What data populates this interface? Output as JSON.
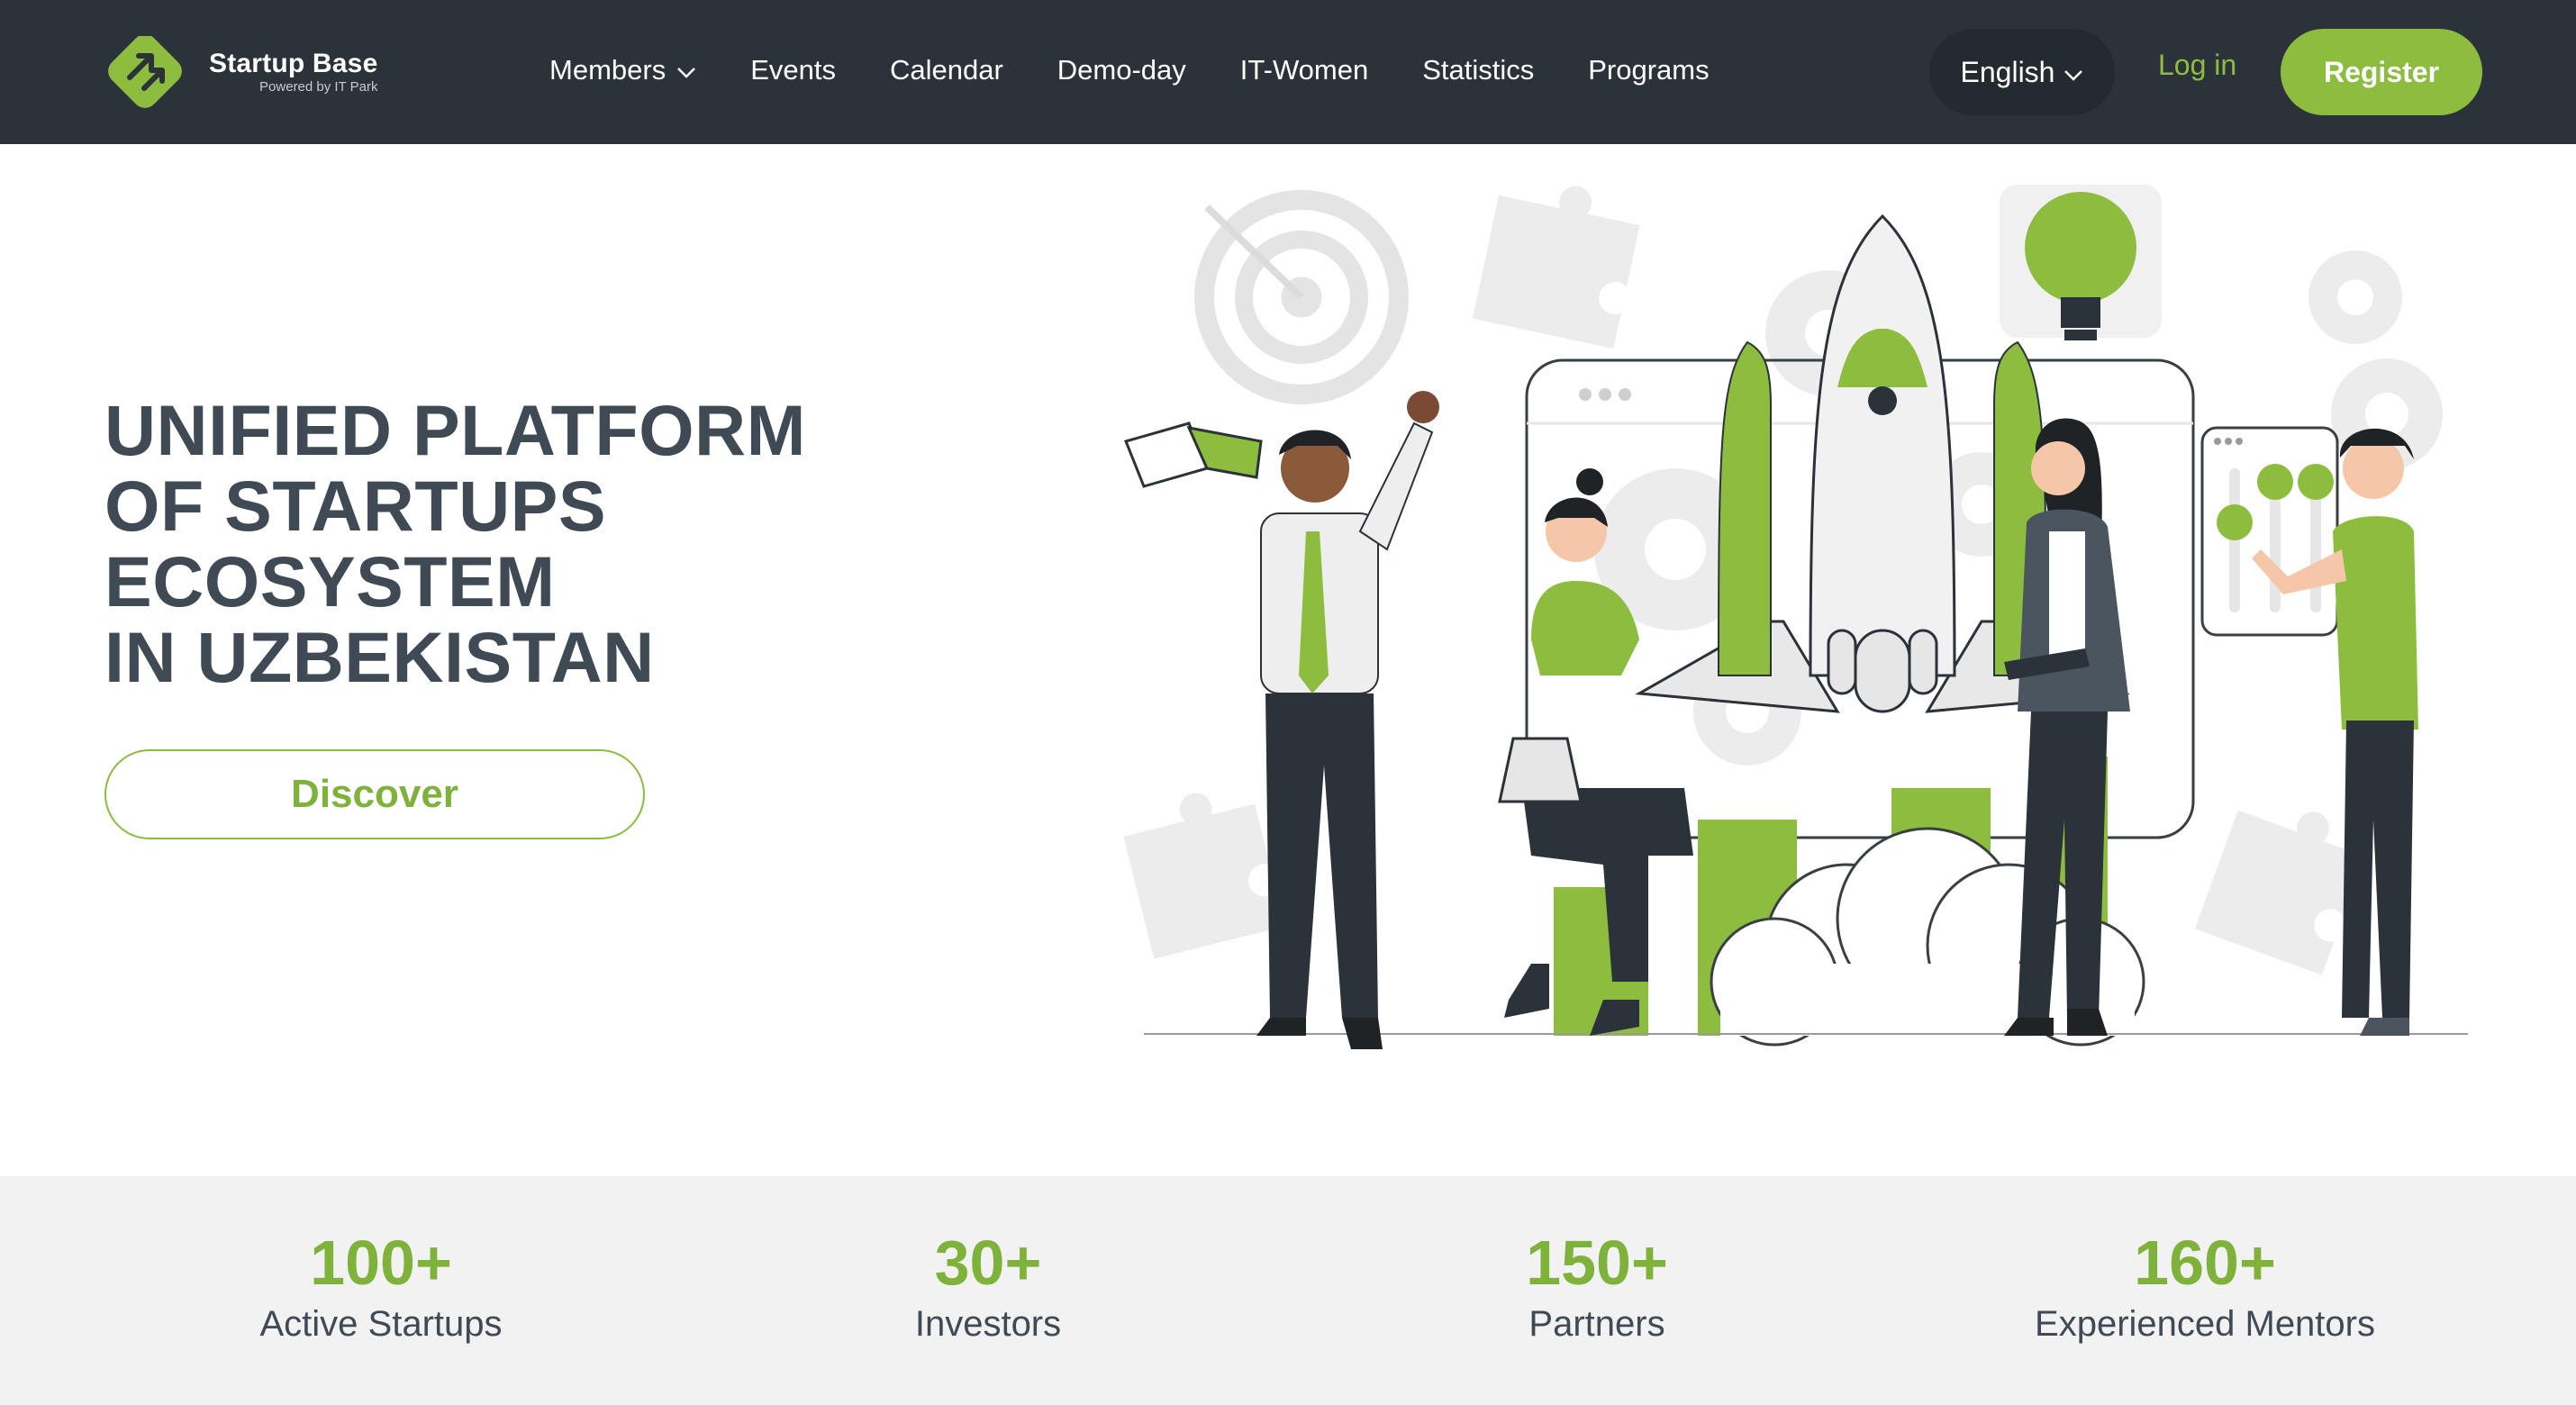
{
  "header": {
    "logo_name": "Startup Base",
    "logo_sub": "Powered by IT Park",
    "nav": [
      {
        "label": "Members",
        "has_dropdown": true
      },
      {
        "label": "Events"
      },
      {
        "label": "Calendar"
      },
      {
        "label": "Demo-day"
      },
      {
        "label": "IT-Women"
      },
      {
        "label": "Statistics"
      },
      {
        "label": "Programs"
      }
    ],
    "language": "English",
    "login_label": "Log in",
    "register_label": "Register"
  },
  "hero": {
    "title_lines": [
      "UNIFIED PLATFORM",
      "OF STARTUPS",
      "ECOSYSTEM",
      "IN UZBEKISTAN"
    ],
    "cta_label": "Discover"
  },
  "stats": [
    {
      "value": "100+",
      "label": "Active Startups"
    },
    {
      "value": "30+",
      "label": "Investors"
    },
    {
      "value": "150+",
      "label": "Partners"
    },
    {
      "value": "160+",
      "label": "Experienced Mentors"
    }
  ],
  "colors": {
    "header_bg": "#2b3239",
    "accent_green": "#8dbd3f",
    "title_text": "#3f4a55",
    "stats_bg": "#f2f2f2"
  }
}
